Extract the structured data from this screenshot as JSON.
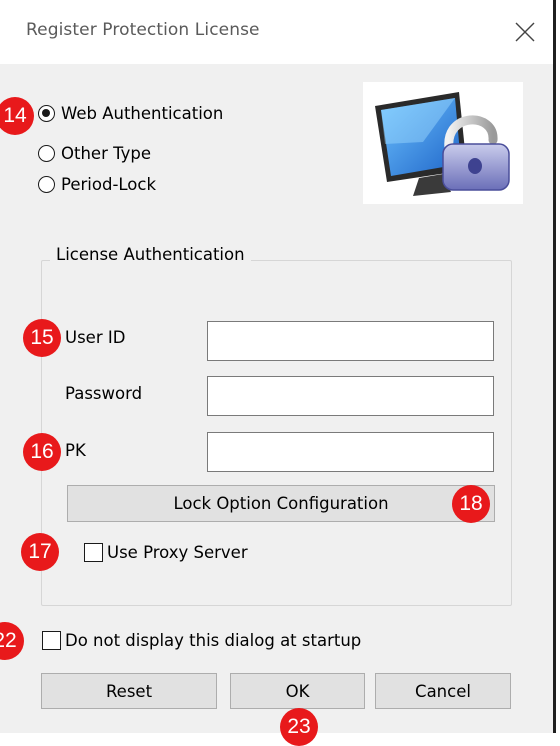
{
  "window": {
    "title": "Register Protection License",
    "close_icon": "close-icon"
  },
  "auth_type": {
    "options": [
      {
        "label": "Web Authentication",
        "selected": true
      },
      {
        "label": "Other Type",
        "selected": false
      },
      {
        "label": "Period-Lock",
        "selected": false
      }
    ]
  },
  "illustration": "monitor-lock-icon",
  "license": {
    "group_label": "License Authentication",
    "user_id_label": "User ID",
    "user_id_value": "",
    "password_label": "Password",
    "password_value": "",
    "pk_label": "PK",
    "pk_value": "",
    "lock_option_button": "Lock Option Configuration",
    "use_proxy_label": "Use Proxy Server",
    "use_proxy_checked": false
  },
  "startup": {
    "label": "Do not display this dialog at startup",
    "checked": false
  },
  "buttons": {
    "reset": "Reset",
    "ok": "OK",
    "cancel": "Cancel"
  },
  "annotations": {
    "b14": "14",
    "b15": "15",
    "b16": "16",
    "b17": "17",
    "b18": "18",
    "b22": "22",
    "b23": "23",
    "badge_color": "#e8191b"
  }
}
